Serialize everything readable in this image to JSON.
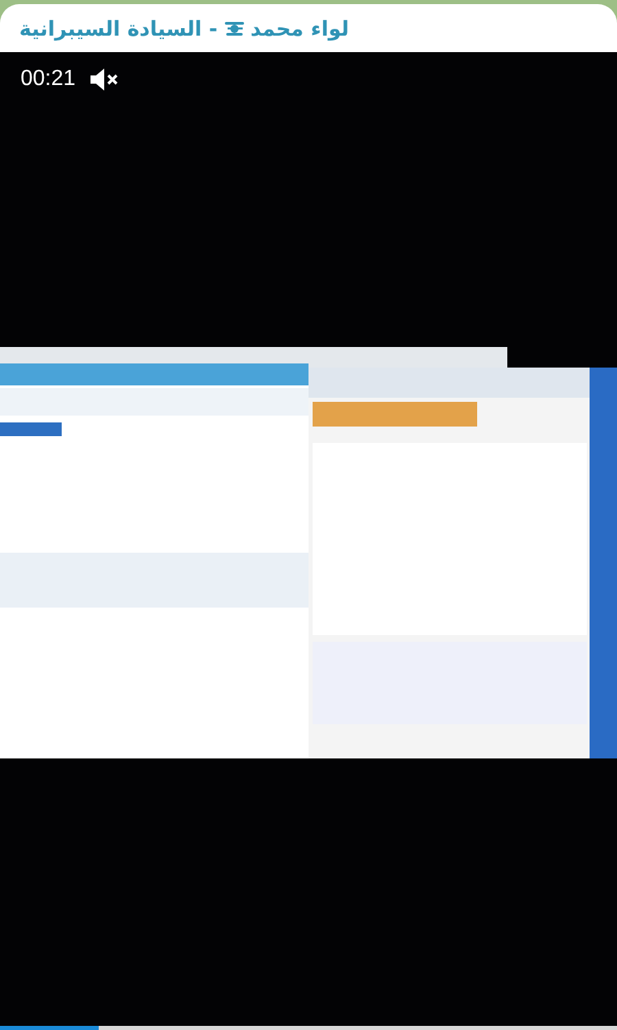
{
  "header": {
    "name": "لواء محمد",
    "channel": "- السيادة السيبرانية"
  },
  "video": {
    "time": "00:21",
    "muted": true,
    "progress": {
      "level": 0.16
    }
  }
}
